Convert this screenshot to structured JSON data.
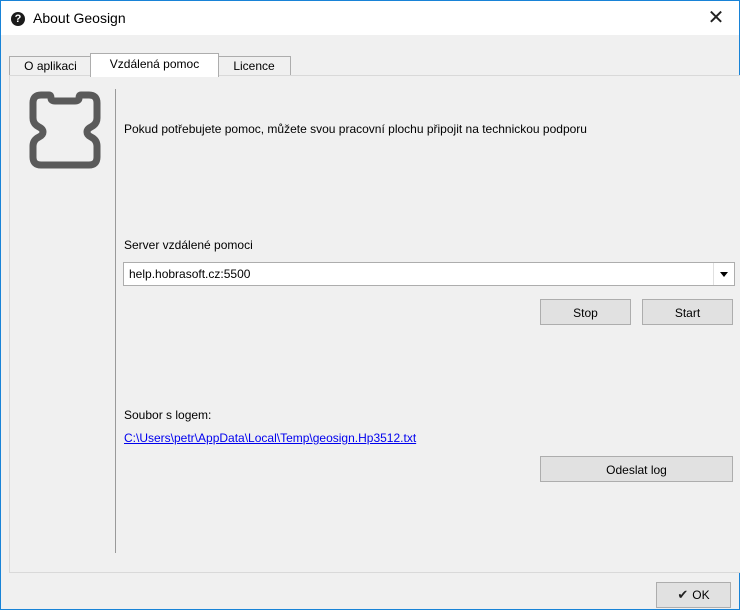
{
  "window": {
    "title": "About Geosign",
    "close_glyph": "✕",
    "title_icon_glyph": "?"
  },
  "tabs": [
    {
      "label": "O aplikaci",
      "active": false
    },
    {
      "label": "Vzdálená pomoc",
      "active": true
    },
    {
      "label": "Licence",
      "active": false
    }
  ],
  "main": {
    "help_text": "Pokud potřebujete pomoc, můžete svou pracovní plochu připojit na technickou podporu",
    "server_label": "Server vzdálené pomoci",
    "server_value": "help.hobrasoft.cz:5500",
    "stop_label": "Stop",
    "start_label": "Start",
    "log_label": "Soubor s logem:",
    "log_path": "C:\\Users\\petr\\AppData\\Local\\Temp\\geosign.Hp3512.txt",
    "send_log_label": "Odeslat log"
  },
  "footer": {
    "ok_label": "OK",
    "ok_icon": "check-icon"
  },
  "colors": {
    "link": "#0000ee",
    "window_border": "#1883d7",
    "logo": "#5a5a5a"
  }
}
